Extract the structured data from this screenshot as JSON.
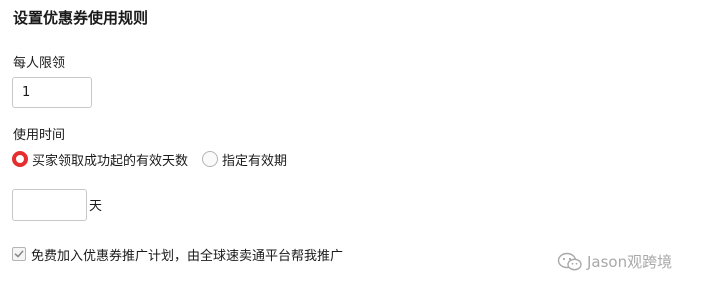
{
  "title": "设置优惠券使用规则",
  "per_person_limit": {
    "label": "每人限领",
    "value": "1"
  },
  "usage_time": {
    "label": "使用时间",
    "options": [
      {
        "label": "买家领取成功起的有效天数",
        "selected": true
      },
      {
        "label": "指定有效期",
        "selected": false
      }
    ],
    "days_value": "",
    "days_unit": "天"
  },
  "promotion": {
    "label": "免费加入优惠券推广计划，由全球速卖通平台帮我推广",
    "checked": true
  },
  "watermark": {
    "text": "Jason观跨境",
    "icon": "wechat-icon"
  },
  "colors": {
    "accent": "#e62e2e",
    "watermark": "#a9a9a9"
  }
}
